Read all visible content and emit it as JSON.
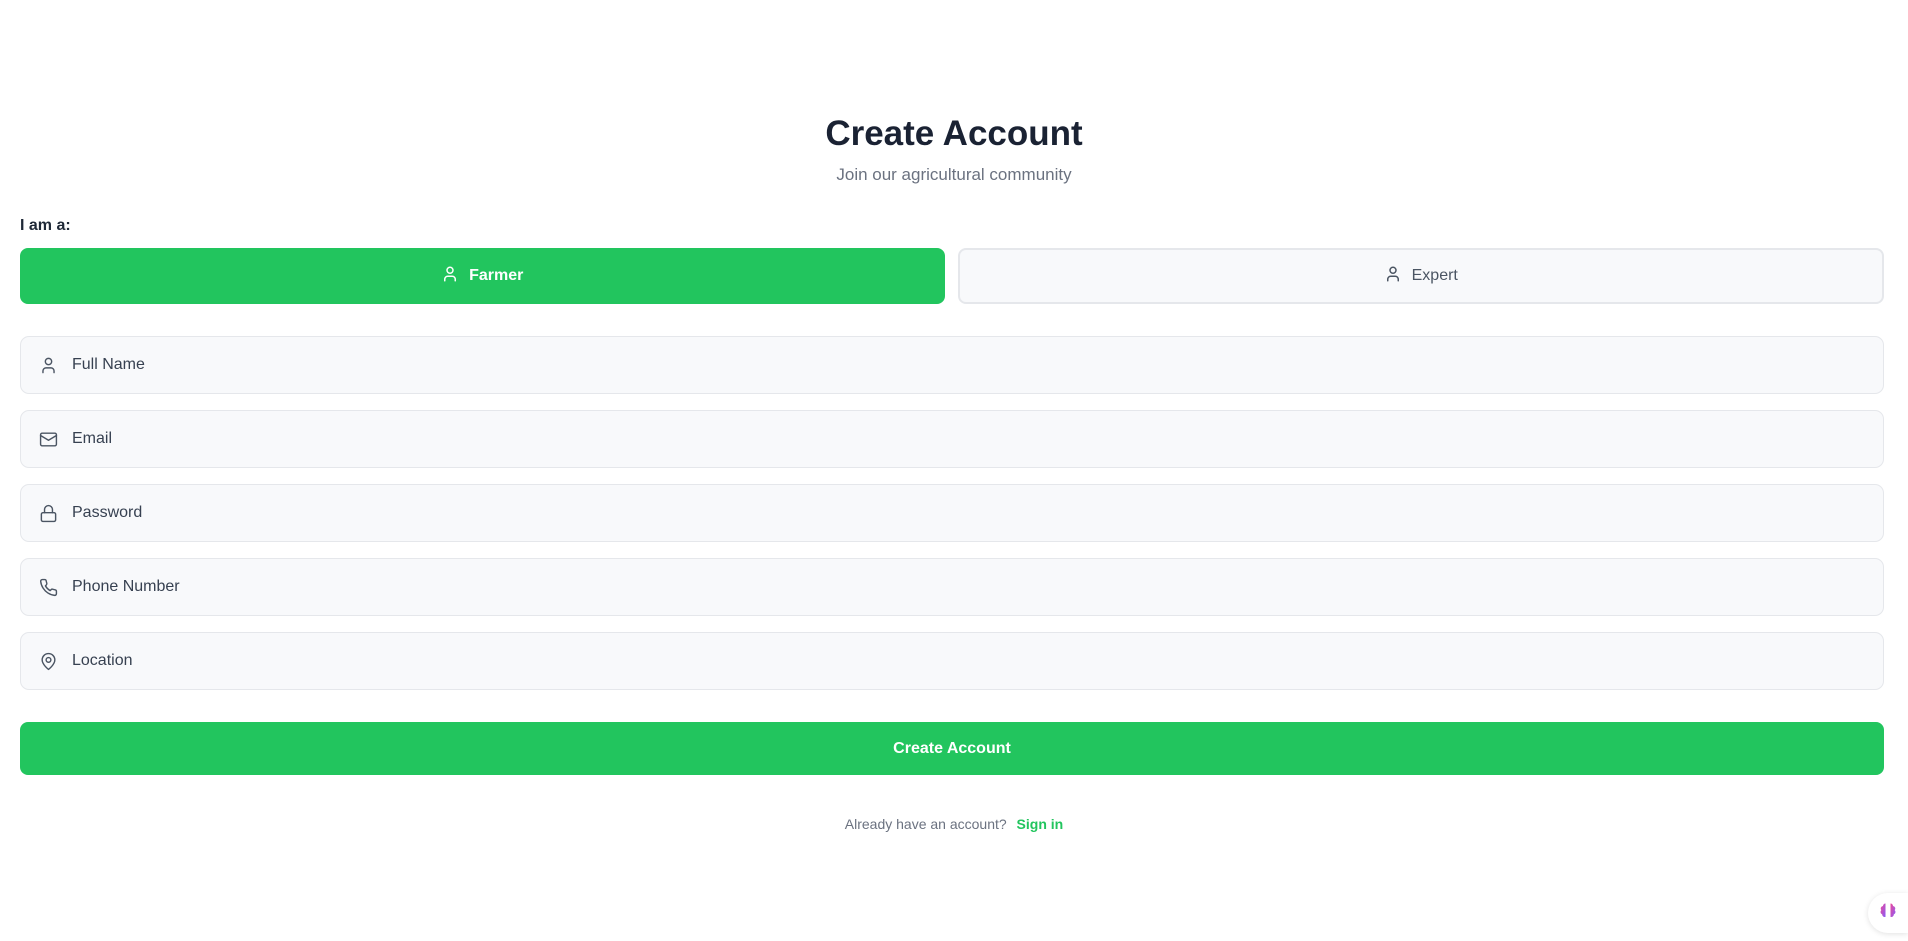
{
  "header": {
    "title": "Create Account",
    "subtitle": "Join our agricultural community"
  },
  "role": {
    "label": "I am a:",
    "options": [
      {
        "label": "Farmer",
        "icon": "user-icon",
        "selected": true
      },
      {
        "label": "Expert",
        "icon": "user-icon",
        "selected": false
      }
    ]
  },
  "fields": {
    "full_name": {
      "placeholder": "Full Name",
      "value": "",
      "icon": "user-icon"
    },
    "email": {
      "placeholder": "Email",
      "value": "",
      "icon": "mail-icon"
    },
    "password": {
      "placeholder": "Password",
      "value": "",
      "icon": "lock-icon"
    },
    "phone": {
      "placeholder": "Phone Number",
      "value": "",
      "icon": "phone-icon"
    },
    "location": {
      "placeholder": "Location",
      "value": "",
      "icon": "map-pin-icon"
    }
  },
  "submit": {
    "label": "Create Account"
  },
  "footer": {
    "prompt": "Already have an account?",
    "link": "Sign in"
  },
  "colors": {
    "accent": "#22c55e",
    "title": "#1a2233",
    "muted": "#6b7280",
    "field_bg": "#f8f9fb",
    "border": "#e5e7eb"
  },
  "floating": {
    "icon": "brain-icon"
  }
}
